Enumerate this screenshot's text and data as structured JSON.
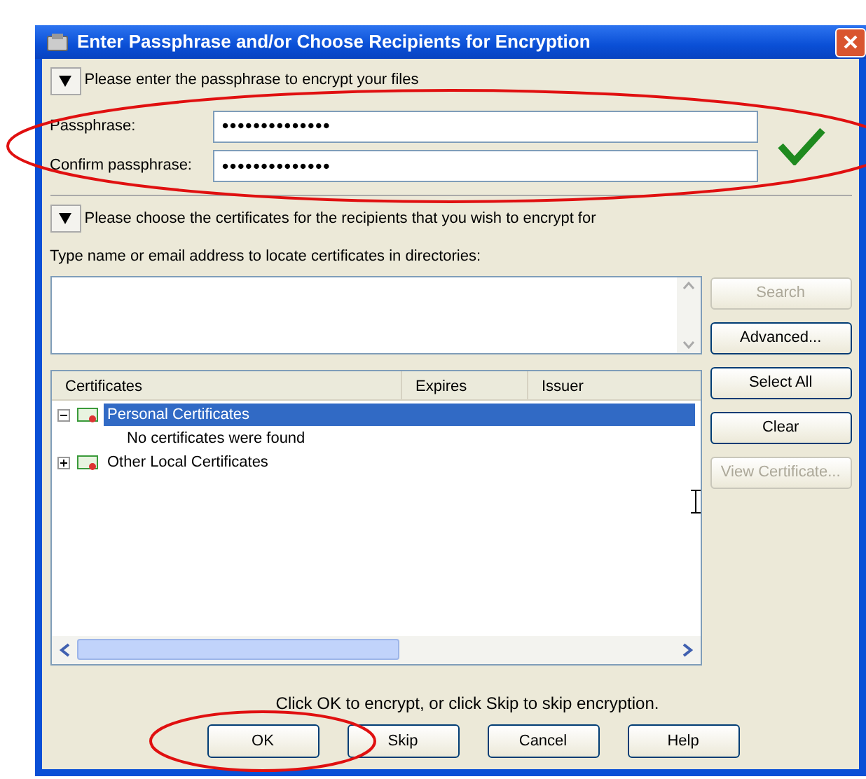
{
  "window": {
    "title": "Enter Passphrase and/or Choose Recipients for Encryption"
  },
  "passphrase_section": {
    "heading": "Please enter the passphrase to encrypt your files",
    "expanded": true,
    "circled": true,
    "fields": [
      {
        "label": "Passphrase:",
        "value": "••••••••••••••"
      },
      {
        "label": "Confirm passphrase:",
        "value": "••••••••••••••"
      }
    ],
    "match": true
  },
  "recipients_section": {
    "heading": "Please choose the certificates for the recipients that you wish to encrypt for",
    "expanded": true,
    "search_label": "Type name or email address to locate certificates in directories:",
    "side_buttons": [
      {
        "label": "Search",
        "disabled": true
      },
      {
        "label": "Advanced...",
        "disabled": false
      },
      {
        "label": "Select All",
        "disabled": false
      },
      {
        "label": "Clear",
        "disabled": false
      },
      {
        "label": "View Certificate...",
        "disabled": true
      }
    ],
    "columns": [
      "Certificates",
      "Expires",
      "Issuer"
    ],
    "tree": [
      {
        "label": "Personal Certificates",
        "expanded": true,
        "selected": true,
        "children": [
          {
            "label": "No certificates were found"
          }
        ]
      },
      {
        "label": "Other Local Certificates",
        "expanded": false,
        "selected": false
      }
    ]
  },
  "hint": "Click OK to encrypt, or click Skip to skip encryption.",
  "buttons": [
    {
      "label": "OK",
      "circled": true
    },
    {
      "label": "Skip",
      "circled": false
    },
    {
      "label": "Cancel",
      "circled": false
    },
    {
      "label": "Help",
      "circled": false
    }
  ]
}
